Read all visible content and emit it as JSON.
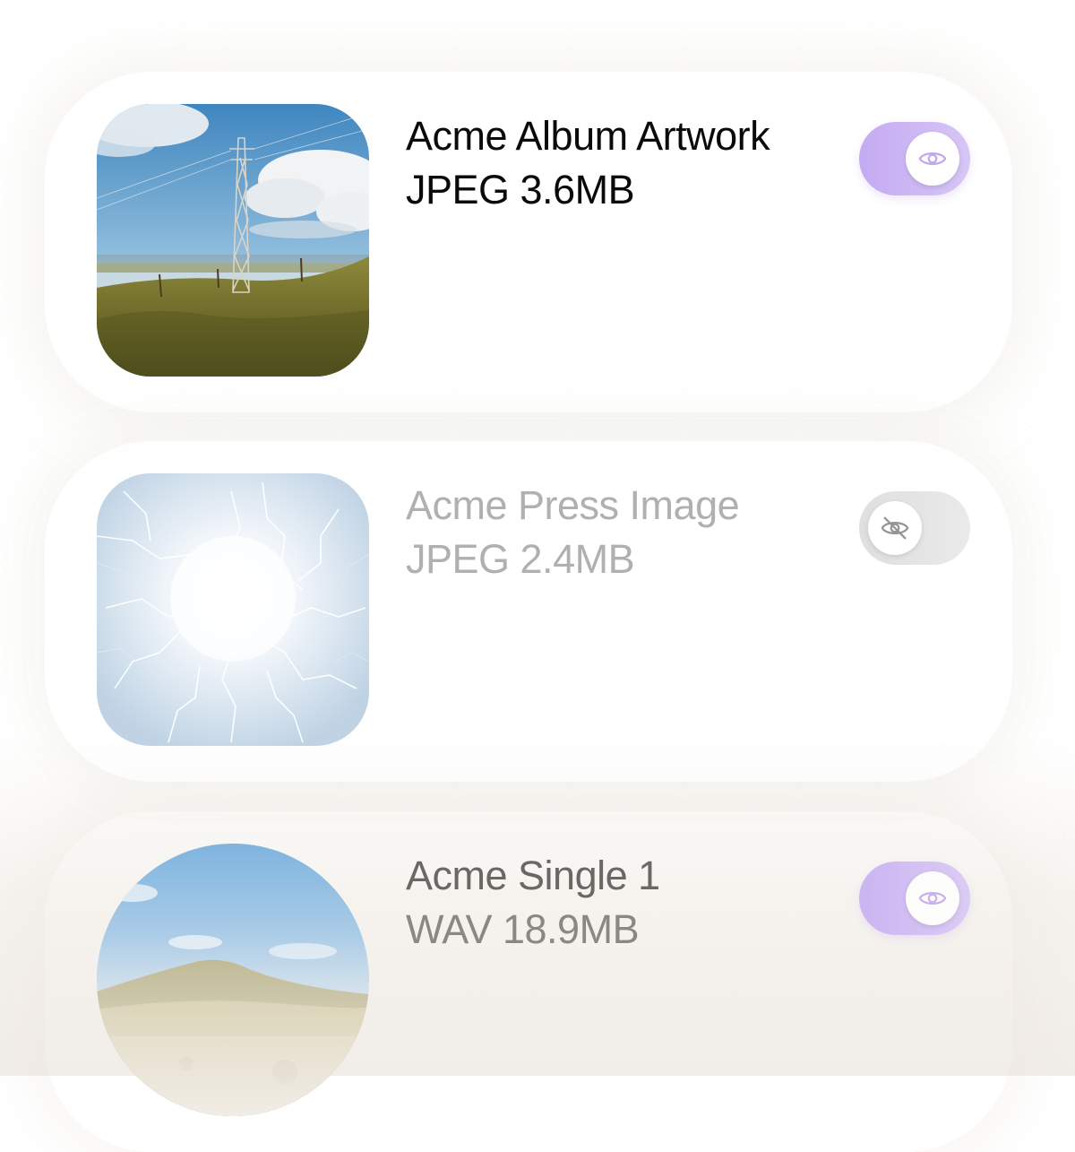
{
  "files": [
    {
      "title": "Acme Album Artwork",
      "meta": "JPEG 3.6MB",
      "thumbnail": "landscape-power-pylon",
      "visible": true,
      "toggle_icon": "eye-icon"
    },
    {
      "title": "Acme Press Image",
      "meta": "JPEG 2.4MB",
      "thumbnail": "lightning-burst",
      "visible": false,
      "toggle_icon": "eye-off-icon"
    },
    {
      "title": "Acme Single 1",
      "meta": "WAV 18.9MB",
      "thumbnail": "hills-landscape",
      "visible": true,
      "toggle_icon": "eye-icon"
    }
  ],
  "colors": {
    "toggle_on": "#c4aaf2",
    "toggle_off": "#dcdcdc",
    "icon_on": "#c2a6ee",
    "icon_off": "#8a8a8a"
  }
}
